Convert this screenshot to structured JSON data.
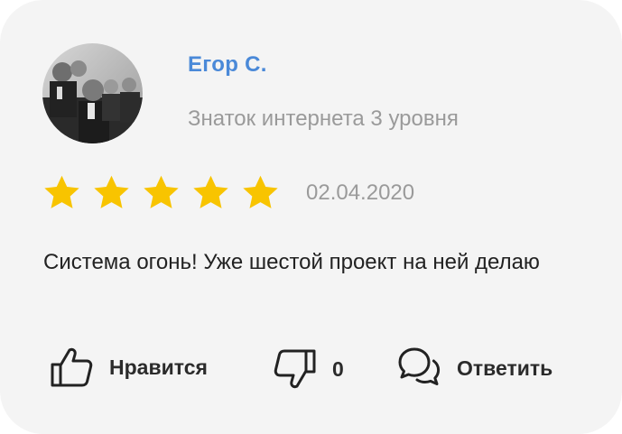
{
  "author": {
    "name": "Егор С.",
    "level": "Знаток интернета 3 уровня"
  },
  "rating": {
    "value": 5,
    "max": 5,
    "star_color": "#f8c400"
  },
  "date": "02.04.2020",
  "review": {
    "text": "Система огонь! Уже шестой проект на ней делаю"
  },
  "actions": {
    "like_label": "Нравится",
    "dislike_count": "0",
    "reply_label": "Ответить"
  },
  "icons": {
    "like": "thumbs-up-icon",
    "dislike": "thumbs-down-icon",
    "reply": "speech-bubbles-icon"
  },
  "colors": {
    "author_name": "#4a89d8",
    "muted_text": "#9a9a9a",
    "card_bg": "#f4f4f4"
  }
}
